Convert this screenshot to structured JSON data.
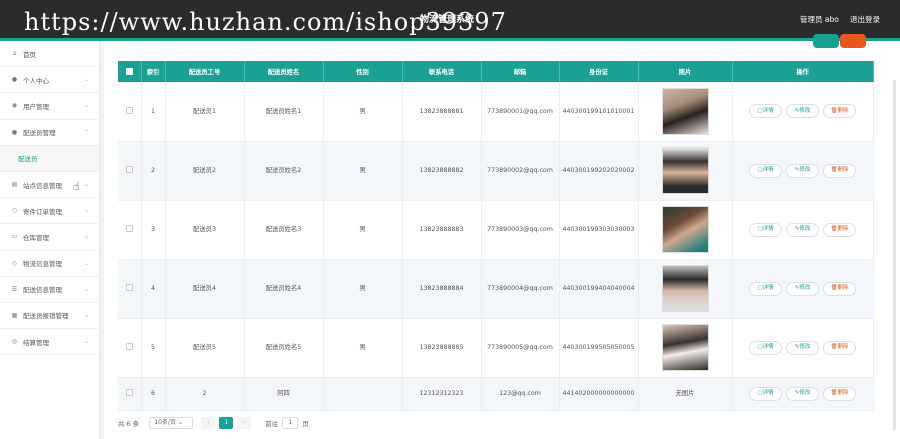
{
  "header": {
    "watermark": "https://www.huzhan.com/ishop39397",
    "system_title": "物流管理系统",
    "user_label": "管理员 abo",
    "logout_label": "退出登录"
  },
  "sidebar": {
    "items": [
      {
        "label": "首页",
        "icon": "home-icon",
        "glyph": "⌂"
      },
      {
        "label": "个人中心",
        "icon": "person-icon",
        "glyph": "●"
      },
      {
        "label": "用户管理",
        "icon": "user-icon",
        "glyph": "◉"
      },
      {
        "label": "配送员管理",
        "icon": "courier-icon",
        "glyph": "●"
      },
      {
        "label": "配送员",
        "icon": "",
        "glyph": ""
      },
      {
        "label": "站点信息管理",
        "icon": "station-icon",
        "glyph": "▤"
      },
      {
        "label": "寄件订单管理",
        "icon": "order-icon",
        "glyph": "○"
      },
      {
        "label": "仓库管理",
        "icon": "warehouse-icon",
        "glyph": "▭"
      },
      {
        "label": "物流信息管理",
        "icon": "logistics-icon",
        "glyph": "◇"
      },
      {
        "label": "配送信息管理",
        "icon": "delivery-icon",
        "glyph": "☰"
      },
      {
        "label": "配送员报销管理",
        "icon": "reimburse-icon",
        "glyph": "▦"
      },
      {
        "label": "结算管理",
        "icon": "settle-icon",
        "glyph": "◎"
      }
    ]
  },
  "table": {
    "headers": [
      "索引",
      "配送员工号",
      "配送员姓名",
      "性别",
      "联系电话",
      "邮箱",
      "身份证",
      "照片",
      "操作"
    ],
    "rows": [
      {
        "index": "1",
        "no": "配送员1",
        "name": "配送员姓名1",
        "gender": "男",
        "phone": "13823888881",
        "email": "773890001@qq.com",
        "id_card": "440300199101010001",
        "photo": "photo-1"
      },
      {
        "index": "2",
        "no": "配送员2",
        "name": "配送员姓名2",
        "gender": "男",
        "phone": "13823888882",
        "email": "773890002@qq.com",
        "id_card": "440300199202020002",
        "photo": "photo-2"
      },
      {
        "index": "3",
        "no": "配送员3",
        "name": "配送员姓名3",
        "gender": "男",
        "phone": "13823888883",
        "email": "773890003@qq.com",
        "id_card": "440300199303030003",
        "photo": "photo-3"
      },
      {
        "index": "4",
        "no": "配送员4",
        "name": "配送员姓名4",
        "gender": "男",
        "phone": "13823888884",
        "email": "773890004@qq.com",
        "id_card": "440300199404040004",
        "photo": "photo-4"
      },
      {
        "index": "5",
        "no": "配送员5",
        "name": "配送员姓名5",
        "gender": "男",
        "phone": "13823888885",
        "email": "773890005@qq.com",
        "id_card": "440300199505050005",
        "photo": "photo-5"
      },
      {
        "index": "6",
        "no": "2",
        "name": "阿四",
        "gender": "",
        "phone": "12312312323",
        "email": "123@qq.com",
        "id_card": "441402000000000000",
        "photo_text": "无图片"
      }
    ],
    "actions": {
      "detail": "详情",
      "edit": "修改",
      "delete": "删除"
    }
  },
  "pagination": {
    "total": "共 6 条",
    "page_size": "10条/页",
    "prev": "‹",
    "current": "1",
    "next": "›",
    "goto_label": "前往",
    "goto_value": "1",
    "page_suffix": "页"
  },
  "colors": {
    "accent": "#1aa094",
    "danger": "#e8571c",
    "header_bg": "#2b2b2b"
  }
}
